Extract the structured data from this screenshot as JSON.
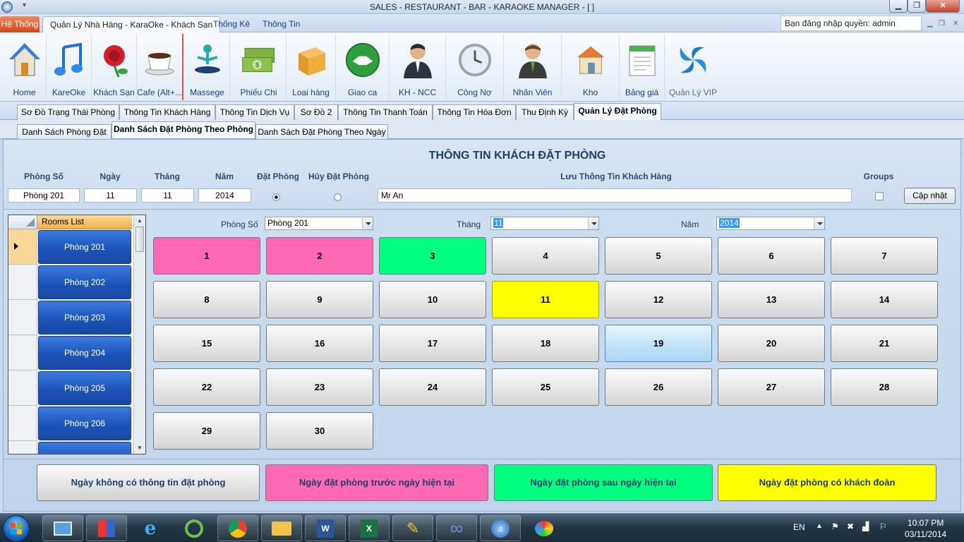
{
  "window": {
    "title": "SALES - RESTAURANT - BAR - KARAOKE MANAGER - [      ]"
  },
  "menu": {
    "tabs": [
      "Hệ Thống",
      "Quản Lý Nhà Hàng - KaraOke - Khách Sạn",
      "Thống Kê",
      "Thông Tin"
    ],
    "login": "Bạn đăng nhập quyền: admin"
  },
  "ribbon": [
    {
      "label": "Home",
      "icon": "house-icon"
    },
    {
      "label": "KareOke",
      "icon": "music-note-icon"
    },
    {
      "label": "Khách Sạn",
      "icon": "rose-icon"
    },
    {
      "label": "Cafe (Alt+...",
      "icon": "coffee-cup-icon"
    },
    {
      "label": "Massege",
      "icon": "massage-icon"
    },
    {
      "label": "Phiếu Chi",
      "icon": "money-icon"
    },
    {
      "label": "Loại hàng",
      "icon": "box-icon"
    },
    {
      "label": "Giao ca",
      "icon": "handshake-icon"
    },
    {
      "label": "KH - NCC",
      "icon": "businessman-icon"
    },
    {
      "label": "Công Nợ",
      "icon": "clock-icon"
    },
    {
      "label": "Nhân Viên",
      "icon": "employee-icon"
    },
    {
      "label": "Kho",
      "icon": "warehouse-icon"
    },
    {
      "label": "Bảng giá",
      "icon": "price-list-icon"
    },
    {
      "label": "Quản Lý VIP",
      "icon": "vip-swirl-icon"
    }
  ],
  "doc_tabs": [
    "Sơ Đồ Trạng Thái Phòng",
    "Thông Tin Khách Hàng",
    "Thông Tin Dịch Vụ",
    "Sơ Đồ 2",
    "Thông Tin Thanh Toán",
    "Thông Tin Hóa Đơn",
    "Thu Định Kỳ",
    "Quản Lý Đặt Phòng"
  ],
  "sub_tabs": [
    "Danh Sách Phòng Đặt",
    "Danh Sách Đặt Phòng Theo Phòng",
    "Danh Sách Đặt Phòng Theo Ngày"
  ],
  "booking": {
    "title": "THÔNG TIN KHÁCH ĐẶT PHÒNG",
    "headers": {
      "room": "Phòng Số",
      "day": "Ngày",
      "month": "Tháng",
      "year": "Năm",
      "book": "Đặt Phòng",
      "cancel": "Hủy Đặt Phòng",
      "note": "Lưu Thông Tin Khách Hàng",
      "groups": "Groups"
    },
    "values": {
      "room": "Phòng 201",
      "day": "11",
      "month": "11",
      "year": "2014",
      "note": "Mr An"
    },
    "update_button": "Cập nhật"
  },
  "rooms_list": {
    "header": "Rooms List",
    "items": [
      "Phòng 201",
      "Phòng 202",
      "Phòng 203",
      "Phòng 204",
      "Phòng 205",
      "Phòng 206",
      ""
    ]
  },
  "filters": {
    "room_label": "Phòng Số",
    "room_value": "Phòng 201",
    "month_label": "Tháng",
    "month_value": "11",
    "year_label": "Năm",
    "year_value": "2014"
  },
  "calendar": {
    "days": [
      "1",
      "2",
      "3",
      "4",
      "5",
      "6",
      "7",
      "8",
      "9",
      "10",
      "11",
      "12",
      "13",
      "14",
      "15",
      "16",
      "17",
      "18",
      "19",
      "20",
      "21",
      "22",
      "23",
      "24",
      "25",
      "26",
      "27",
      "28",
      "29",
      "30"
    ],
    "status": {
      "1": "pink",
      "2": "pink",
      "3": "green",
      "11": "yellow",
      "19": "hover"
    }
  },
  "legend": [
    "Ngày không có thông tin đặt phòng",
    "Ngày đặt phòng trước ngày hiện tại",
    "Ngày đặt phòng sau ngày hiện tại",
    "Ngày đặt phòng có khách đoàn"
  ],
  "colors": {
    "pink": "#ff69b4",
    "green": "#00ff7f",
    "yellow": "#ffff00",
    "room_blue": "#1d54b8"
  },
  "taskbar": {
    "lang": "EN",
    "time": "10:07 PM",
    "date": "03/11/2014"
  }
}
